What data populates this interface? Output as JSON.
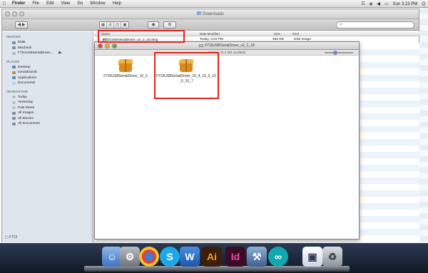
{
  "menubar": {
    "app": "Finder",
    "items": [
      "File",
      "Edit",
      "View",
      "Go",
      "Window",
      "Help"
    ],
    "clock": "Sun 3:23 PM",
    "extra": "Q"
  },
  "finder": {
    "title": "Downloads",
    "columns": {
      "name": "Name",
      "date": "Date Modified",
      "size": "Size",
      "kind": "Kind"
    },
    "row": {
      "name": "FTDIUSBSerialDriver_v2_2_18.dmg",
      "date": "Today, 3:22 PM",
      "size": "450 KB",
      "kind": "Disk Image"
    }
  },
  "sidebar": {
    "devices_header": "DEVICES",
    "devices": [
      "iDisk",
      "Macbook",
      "FTDIUSBSerialDriver..."
    ],
    "places_header": "PLACES",
    "places": [
      "Desktop",
      "tomasbrandt",
      "Applications",
      "Documents"
    ],
    "search_header": "SEARCH FOR",
    "search": [
      "Today",
      "Yesterday",
      "Past Week",
      "All Images",
      "All Movies",
      "All Documents"
    ],
    "bottom": "FTDI"
  },
  "volume": {
    "title": "FTDIUSBSerialDriver_v2_2_18",
    "status": "2 items, 10.4 MB available",
    "items": [
      "FTDIUSBSerialDriver_10_3",
      "FTDIUSBSerialDriver_10_4_10_5_10_6_10_7"
    ]
  },
  "dock": {
    "icons": [
      "finder-icon",
      "system-prefs-icon",
      "chrome-icon",
      "skype-icon",
      "word-icon",
      "illustrator-icon",
      "indesign-icon",
      "xcode-icon",
      "arduino-icon",
      "preview-icon",
      "trash-icon"
    ]
  }
}
